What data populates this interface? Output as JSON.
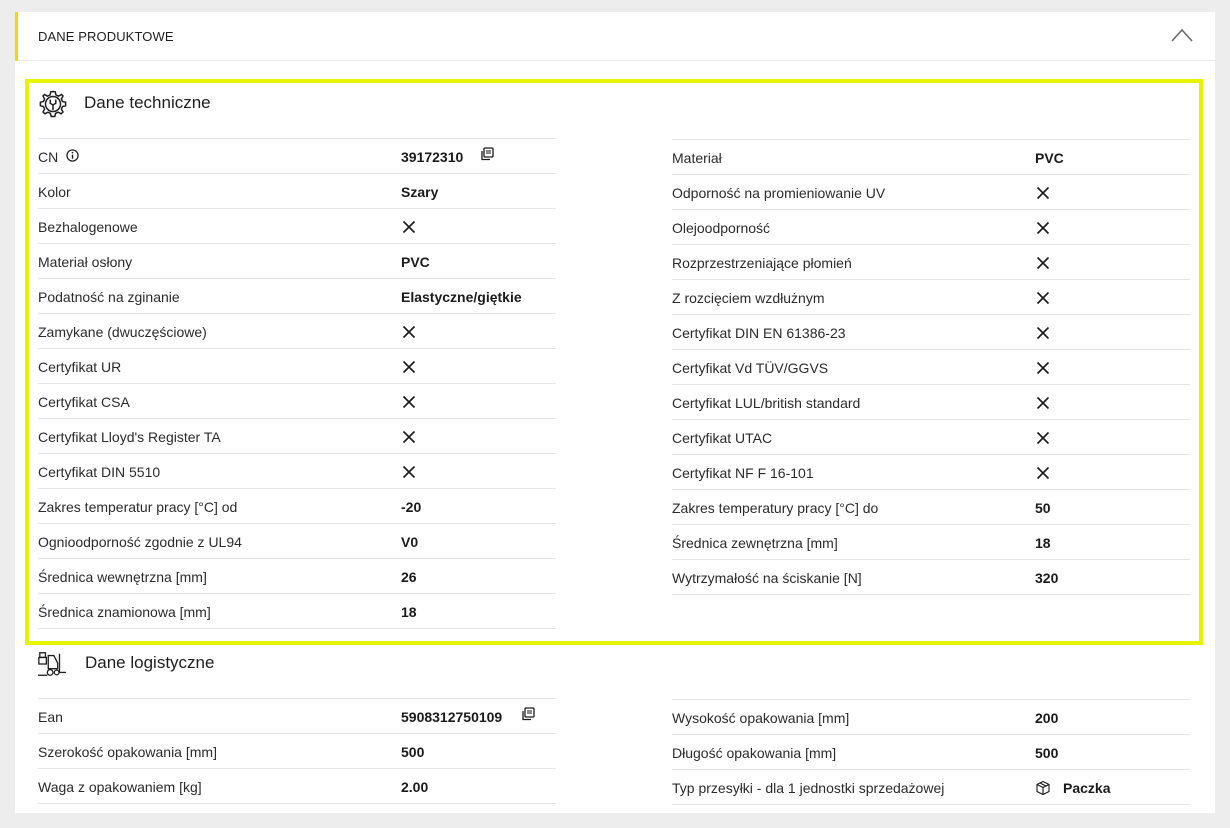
{
  "panel": {
    "title": "DANE PRODUKTOWE",
    "collapse_icon": "chevron-up-icon",
    "accent": "#f4d900"
  },
  "technical": {
    "title": "Dane techniczne",
    "icon": "gear-wrench-icon",
    "highlight": "#e6f400",
    "left": [
      {
        "label": "CN",
        "value": "39172310",
        "info": true,
        "copy": true
      },
      {
        "label": "Kolor",
        "value": "Szary"
      },
      {
        "label": "Bezhalogenowe",
        "value": null
      },
      {
        "label": "Materiał osłony",
        "value": "PVC"
      },
      {
        "label": "Podatność na zginanie",
        "value": "Elastyczne/giętkie"
      },
      {
        "label": "Zamykane (dwuczęściowe)",
        "value": null
      },
      {
        "label": "Certyfikat UR",
        "value": null
      },
      {
        "label": "Certyfikat CSA",
        "value": null
      },
      {
        "label": "Certyfikat Lloyd's Register TA",
        "value": null
      },
      {
        "label": "Certyfikat DIN 5510",
        "value": null
      },
      {
        "label": "Zakres temperatur pracy [°C] od",
        "value": "-20"
      },
      {
        "label": "Ognioodporność zgodnie z UL94",
        "value": "V0"
      },
      {
        "label": "Średnica wewnętrzna [mm]",
        "value": "26"
      },
      {
        "label": "Średnica znamionowa [mm]",
        "value": "18"
      }
    ],
    "right": [
      {
        "label": "Materiał",
        "value": "PVC"
      },
      {
        "label": "Odporność na promieniowanie UV",
        "value": null
      },
      {
        "label": "Olejoodporność",
        "value": null
      },
      {
        "label": "Rozprzestrzeniające płomień",
        "value": null
      },
      {
        "label": "Z rozcięciem wzdłużnym",
        "value": null
      },
      {
        "label": "Certyfikat DIN EN 61386-23",
        "value": null
      },
      {
        "label": "Certyfikat Vd TÜV/GGVS",
        "value": null
      },
      {
        "label": "Certyfikat LUL/british standard",
        "value": null
      },
      {
        "label": "Certyfikat UTAC",
        "value": null
      },
      {
        "label": "Certyfikat NF F 16-101",
        "value": null
      },
      {
        "label": "Zakres temperatury pracy [°C] do",
        "value": "50"
      },
      {
        "label": "Średnica zewnętrzna [mm]",
        "value": "18"
      },
      {
        "label": "Wytrzymałość na ściskanie [N]",
        "value": "320"
      }
    ]
  },
  "logistics": {
    "title": "Dane logistyczne",
    "icon": "forklift-icon",
    "left": [
      {
        "label": "Ean",
        "value": "5908312750109",
        "copy": true
      },
      {
        "label": "Szerokość opakowania [mm]",
        "value": "500"
      },
      {
        "label": "Waga z opakowaniem [kg]",
        "value": "2.00"
      }
    ],
    "right": [
      {
        "label": "Wysokość opakowania [mm]",
        "value": "200"
      },
      {
        "label": "Długość opakowania [mm]",
        "value": "500"
      },
      {
        "label": "Typ przesyłki - dla 1 jednostki sprzedażowej",
        "value": "Paczka",
        "box_icon": true
      }
    ]
  }
}
